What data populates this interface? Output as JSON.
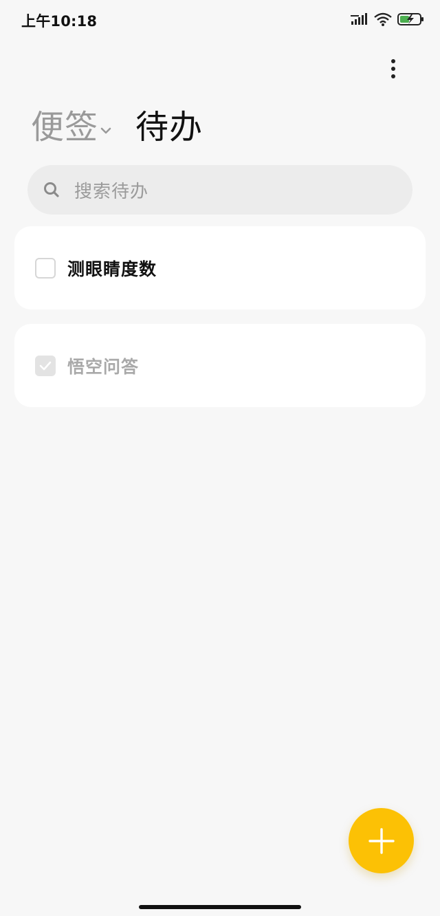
{
  "status_bar": {
    "time": "上午10:18",
    "icons": [
      "signal-icon",
      "wifi-icon",
      "battery-charging-icon"
    ],
    "battery_color": "#4caf50"
  },
  "header": {
    "more_icon": "more-vertical-icon",
    "tabs": [
      {
        "label": "便签",
        "active": false,
        "has_dropdown": true
      },
      {
        "label": "待办",
        "active": true
      }
    ]
  },
  "search": {
    "placeholder": "搜索待办",
    "icon": "search-icon"
  },
  "todos": [
    {
      "text": "测眼睛度数",
      "checked": false
    },
    {
      "text": "悟空问答",
      "checked": true
    }
  ],
  "fab": {
    "icon": "plus-icon",
    "color": "#fcc105"
  }
}
